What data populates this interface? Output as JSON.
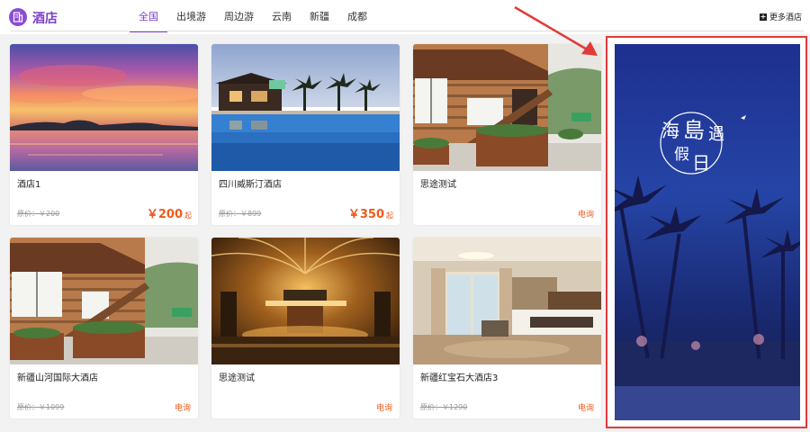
{
  "header": {
    "title": "酒店",
    "tabs": [
      {
        "label": "全国",
        "active": true
      },
      {
        "label": "出境游",
        "active": false
      },
      {
        "label": "周边游",
        "active": false
      },
      {
        "label": "云南",
        "active": false
      },
      {
        "label": "新疆",
        "active": false
      },
      {
        "label": "成都",
        "active": false
      }
    ],
    "more_label": "更多酒店"
  },
  "cards": [
    {
      "name": "酒店1",
      "orig": "原价：￥200",
      "price": "￥200",
      "unit": "起",
      "tel": ""
    },
    {
      "name": "四川威斯汀酒店",
      "orig": "原价：￥899",
      "price": "￥350",
      "unit": "起",
      "tel": ""
    },
    {
      "name": "思途测试",
      "orig": "",
      "price": "",
      "unit": "",
      "tel": "电询"
    },
    {
      "name": "新疆山河国际大酒店",
      "orig": "原价：￥1099",
      "price": "",
      "unit": "",
      "tel": "电询"
    },
    {
      "name": "思途测试",
      "orig": "",
      "price": "",
      "unit": "",
      "tel": "电询"
    },
    {
      "name": "新疆红宝石大酒店3",
      "orig": "原价：￥1290",
      "price": "",
      "unit": "",
      "tel": "电询"
    }
  ],
  "banner": {
    "title_chars": [
      "海",
      "島",
      "遇",
      "假",
      "日"
    ]
  },
  "colors": {
    "accent": "#7b3fc9",
    "price": "#ef5a1c",
    "highlight_border": "#e23a3a"
  }
}
